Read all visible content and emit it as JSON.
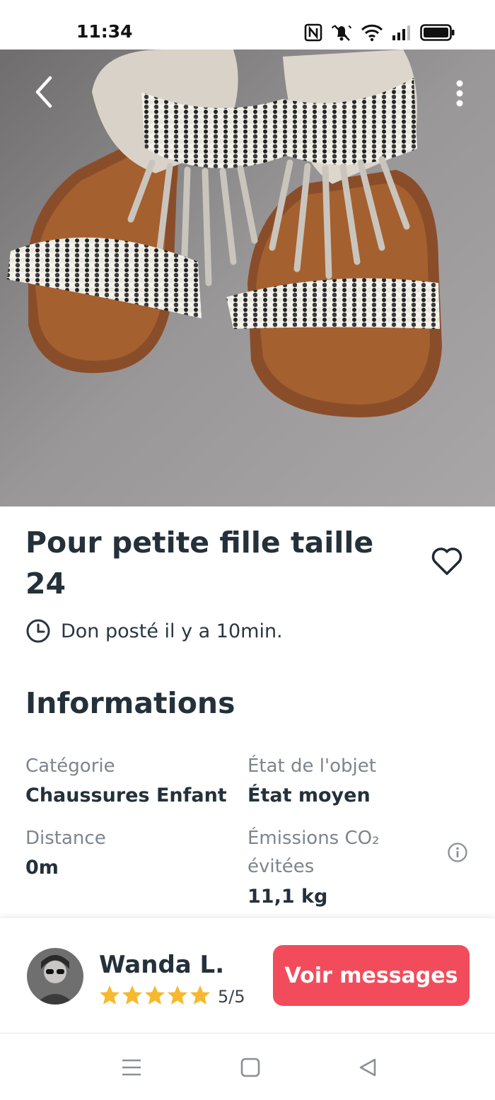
{
  "status_bar": {
    "time": "11:34",
    "icons": [
      "nfc-icon",
      "mute-icon",
      "wifi-icon",
      "signal-icon",
      "battery-icon"
    ]
  },
  "photo": {
    "alt": "Beaded fringe children's sandals",
    "back_icon": "chevron-left-icon",
    "more_icon": "more-vertical-icon"
  },
  "listing": {
    "title": "Pour petite fille taille 24",
    "posted": "Don posté il y a 10min.",
    "favorite_icon": "heart-outline-icon"
  },
  "info": {
    "heading": "Informations",
    "category_label": "Catégorie",
    "category_value": "Chaussures Enfant",
    "condition_label": "État de l'objet",
    "condition_value": "État moyen",
    "distance_label": "Distance",
    "distance_value": "0m",
    "co2_label_line1": "Émissions CO₂",
    "co2_label_line2": "évitées",
    "co2_value": "11,1 kg"
  },
  "giver": {
    "name": "Wanda L.",
    "rating": "5/5",
    "stars": 5,
    "star_color": "#f7b82d"
  },
  "actions": {
    "messages_label": "Voir messages",
    "accent_color": "#f24c5c"
  },
  "nav": {
    "menu_icon": "menu-icon",
    "home_icon": "square-icon",
    "back_icon": "triangle-back-icon"
  }
}
